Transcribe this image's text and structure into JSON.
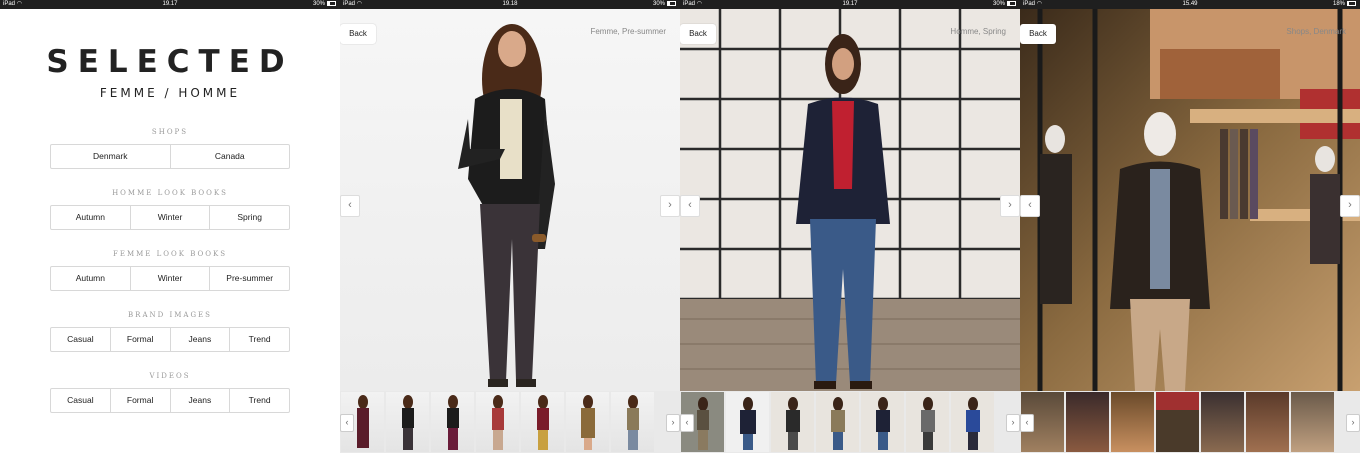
{
  "status_bars": [
    {
      "device": "iPad",
      "time": "19.17",
      "battery": "30%",
      "battery_level": 0.3
    },
    {
      "device": "iPad",
      "time": "19.18",
      "battery": "30%",
      "battery_level": 0.3
    },
    {
      "device": "iPad",
      "time": "19.17",
      "battery": "30%",
      "battery_level": 0.3
    },
    {
      "device": "iPad",
      "time": "15.49",
      "battery": "18%",
      "battery_level": 0.18
    }
  ],
  "menu": {
    "logo": "SELECTED",
    "logo_sub": "FEMME / HOMME",
    "sections": [
      {
        "title": "SHOPS",
        "buttons": [
          "Denmark",
          "Canada"
        ]
      },
      {
        "title": "HOMME LOOK BOOKS",
        "buttons": [
          "Autumn",
          "Winter",
          "Spring"
        ]
      },
      {
        "title": "FEMME LOOK BOOKS",
        "buttons": [
          "Autumn",
          "Winter",
          "Pre-summer"
        ]
      },
      {
        "title": "BRAND IMAGES",
        "buttons": [
          "Casual",
          "Formal",
          "Jeans",
          "Trend"
        ]
      },
      {
        "title": "VIDEOS",
        "buttons": [
          "Casual",
          "Formal",
          "Jeans",
          "Trend"
        ]
      }
    ]
  },
  "galleries": [
    {
      "back_label": "Back",
      "caption": "Femme, Pre-summer",
      "prev": "‹",
      "next": "›"
    },
    {
      "back_label": "Back",
      "caption": "Homme, Spring",
      "prev": "‹",
      "next": "›"
    },
    {
      "back_label": "Back",
      "caption": "Shops, Denmark",
      "prev": "‹",
      "next": "›"
    }
  ],
  "colors": {
    "statusbar": "#1f1f1f",
    "button_border": "#d8d8d8",
    "section_title": "#999999",
    "caption": "#888888"
  }
}
